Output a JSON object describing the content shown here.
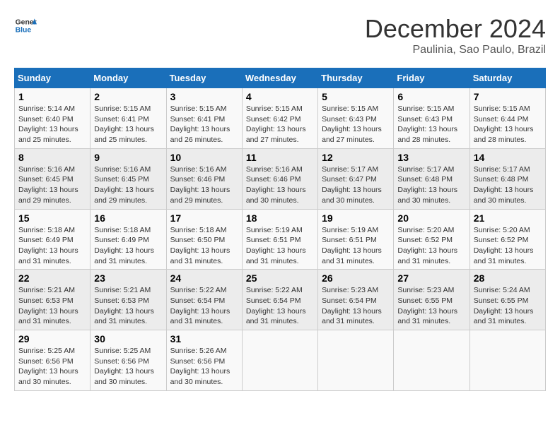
{
  "logo": {
    "line1": "General",
    "line2": "Blue"
  },
  "title": "December 2024",
  "subtitle": "Paulinia, Sao Paulo, Brazil",
  "days_header": [
    "Sunday",
    "Monday",
    "Tuesday",
    "Wednesday",
    "Thursday",
    "Friday",
    "Saturday"
  ],
  "weeks": [
    [
      {
        "day": "1",
        "sunrise": "5:14 AM",
        "sunset": "6:40 PM",
        "daylight": "13 hours and 25 minutes."
      },
      {
        "day": "2",
        "sunrise": "5:15 AM",
        "sunset": "6:41 PM",
        "daylight": "13 hours and 25 minutes."
      },
      {
        "day": "3",
        "sunrise": "5:15 AM",
        "sunset": "6:41 PM",
        "daylight": "13 hours and 26 minutes."
      },
      {
        "day": "4",
        "sunrise": "5:15 AM",
        "sunset": "6:42 PM",
        "daylight": "13 hours and 27 minutes."
      },
      {
        "day": "5",
        "sunrise": "5:15 AM",
        "sunset": "6:43 PM",
        "daylight": "13 hours and 27 minutes."
      },
      {
        "day": "6",
        "sunrise": "5:15 AM",
        "sunset": "6:43 PM",
        "daylight": "13 hours and 28 minutes."
      },
      {
        "day": "7",
        "sunrise": "5:15 AM",
        "sunset": "6:44 PM",
        "daylight": "13 hours and 28 minutes."
      }
    ],
    [
      {
        "day": "8",
        "sunrise": "5:16 AM",
        "sunset": "6:45 PM",
        "daylight": "13 hours and 29 minutes."
      },
      {
        "day": "9",
        "sunrise": "5:16 AM",
        "sunset": "6:45 PM",
        "daylight": "13 hours and 29 minutes."
      },
      {
        "day": "10",
        "sunrise": "5:16 AM",
        "sunset": "6:46 PM",
        "daylight": "13 hours and 29 minutes."
      },
      {
        "day": "11",
        "sunrise": "5:16 AM",
        "sunset": "6:46 PM",
        "daylight": "13 hours and 30 minutes."
      },
      {
        "day": "12",
        "sunrise": "5:17 AM",
        "sunset": "6:47 PM",
        "daylight": "13 hours and 30 minutes."
      },
      {
        "day": "13",
        "sunrise": "5:17 AM",
        "sunset": "6:48 PM",
        "daylight": "13 hours and 30 minutes."
      },
      {
        "day": "14",
        "sunrise": "5:17 AM",
        "sunset": "6:48 PM",
        "daylight": "13 hours and 30 minutes."
      }
    ],
    [
      {
        "day": "15",
        "sunrise": "5:18 AM",
        "sunset": "6:49 PM",
        "daylight": "13 hours and 31 minutes."
      },
      {
        "day": "16",
        "sunrise": "5:18 AM",
        "sunset": "6:49 PM",
        "daylight": "13 hours and 31 minutes."
      },
      {
        "day": "17",
        "sunrise": "5:18 AM",
        "sunset": "6:50 PM",
        "daylight": "13 hours and 31 minutes."
      },
      {
        "day": "18",
        "sunrise": "5:19 AM",
        "sunset": "6:51 PM",
        "daylight": "13 hours and 31 minutes."
      },
      {
        "day": "19",
        "sunrise": "5:19 AM",
        "sunset": "6:51 PM",
        "daylight": "13 hours and 31 minutes."
      },
      {
        "day": "20",
        "sunrise": "5:20 AM",
        "sunset": "6:52 PM",
        "daylight": "13 hours and 31 minutes."
      },
      {
        "day": "21",
        "sunrise": "5:20 AM",
        "sunset": "6:52 PM",
        "daylight": "13 hours and 31 minutes."
      }
    ],
    [
      {
        "day": "22",
        "sunrise": "5:21 AM",
        "sunset": "6:53 PM",
        "daylight": "13 hours and 31 minutes."
      },
      {
        "day": "23",
        "sunrise": "5:21 AM",
        "sunset": "6:53 PM",
        "daylight": "13 hours and 31 minutes."
      },
      {
        "day": "24",
        "sunrise": "5:22 AM",
        "sunset": "6:54 PM",
        "daylight": "13 hours and 31 minutes."
      },
      {
        "day": "25",
        "sunrise": "5:22 AM",
        "sunset": "6:54 PM",
        "daylight": "13 hours and 31 minutes."
      },
      {
        "day": "26",
        "sunrise": "5:23 AM",
        "sunset": "6:54 PM",
        "daylight": "13 hours and 31 minutes."
      },
      {
        "day": "27",
        "sunrise": "5:23 AM",
        "sunset": "6:55 PM",
        "daylight": "13 hours and 31 minutes."
      },
      {
        "day": "28",
        "sunrise": "5:24 AM",
        "sunset": "6:55 PM",
        "daylight": "13 hours and 31 minutes."
      }
    ],
    [
      {
        "day": "29",
        "sunrise": "5:25 AM",
        "sunset": "6:56 PM",
        "daylight": "13 hours and 30 minutes."
      },
      {
        "day": "30",
        "sunrise": "5:25 AM",
        "sunset": "6:56 PM",
        "daylight": "13 hours and 30 minutes."
      },
      {
        "day": "31",
        "sunrise": "5:26 AM",
        "sunset": "6:56 PM",
        "daylight": "13 hours and 30 minutes."
      },
      null,
      null,
      null,
      null
    ]
  ],
  "label_sunrise": "Sunrise:",
  "label_sunset": "Sunset:",
  "label_daylight": "Daylight:"
}
